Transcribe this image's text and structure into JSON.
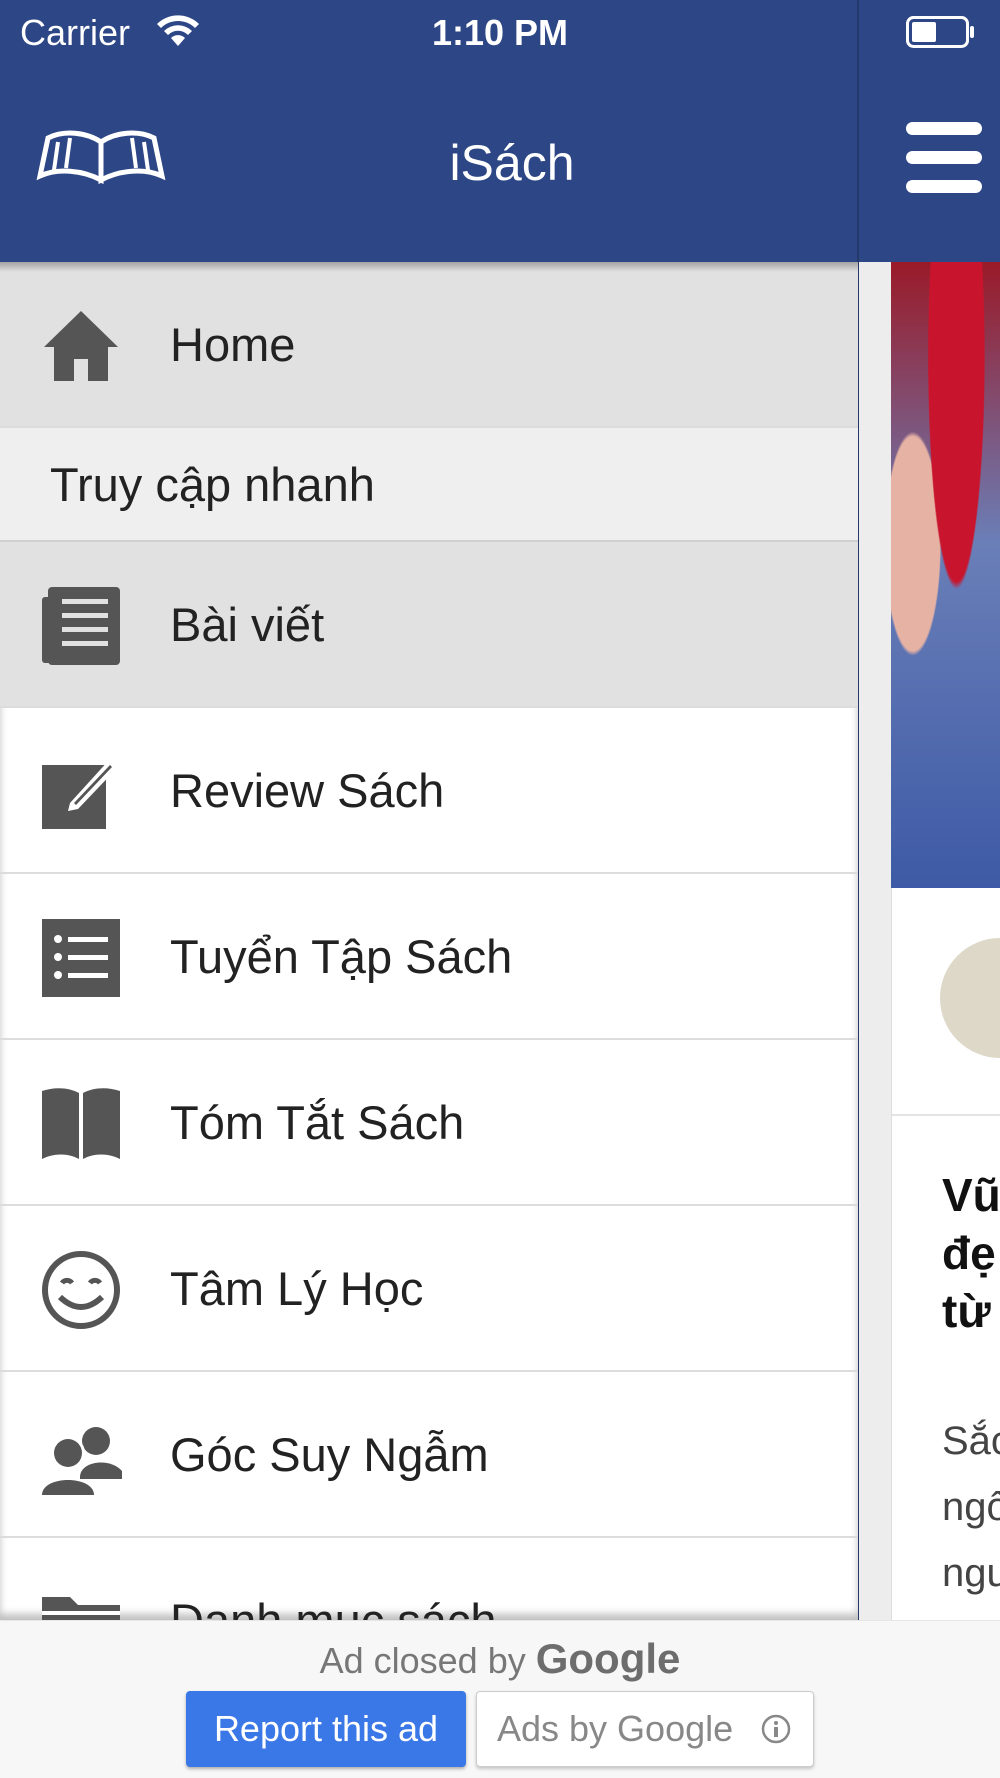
{
  "status_bar": {
    "carrier": "Carrier",
    "time": "1:10 PM"
  },
  "header": {
    "title": "iSách",
    "logo_text": "iSách"
  },
  "drawer": {
    "items": [
      {
        "label": "Home",
        "icon": "home-icon",
        "active": true
      },
      {
        "section": "Truy cập nhanh"
      },
      {
        "label": "Bài viết",
        "icon": "article-icon",
        "active": true
      },
      {
        "label": "Review Sách",
        "icon": "edit-icon"
      },
      {
        "label": "Tuyển Tập Sách",
        "icon": "list-icon"
      },
      {
        "label": "Tóm Tắt Sách",
        "icon": "open-book-icon"
      },
      {
        "label": "Tâm Lý Học",
        "icon": "smile-icon"
      },
      {
        "label": "Góc Suy Ngẫm",
        "icon": "users-icon"
      },
      {
        "label": "Danh mục sách",
        "icon": "folder-icon"
      }
    ]
  },
  "content_peek": {
    "headline_lines": [
      "Vũ",
      "đẹ",
      "từ"
    ],
    "excerpt_lines": [
      "Sắc",
      "ngô",
      "ngu"
    ]
  },
  "ad": {
    "closed_text": "Ad closed by",
    "closed_brand": "Google",
    "report_label": "Report this ad",
    "ads_by_label": "Ads by Google"
  },
  "colors": {
    "header": "#2d4686",
    "active_row": "#e1e1e1",
    "section_row": "#efefef",
    "icon": "#555555",
    "report_button": "#3b78e7"
  }
}
